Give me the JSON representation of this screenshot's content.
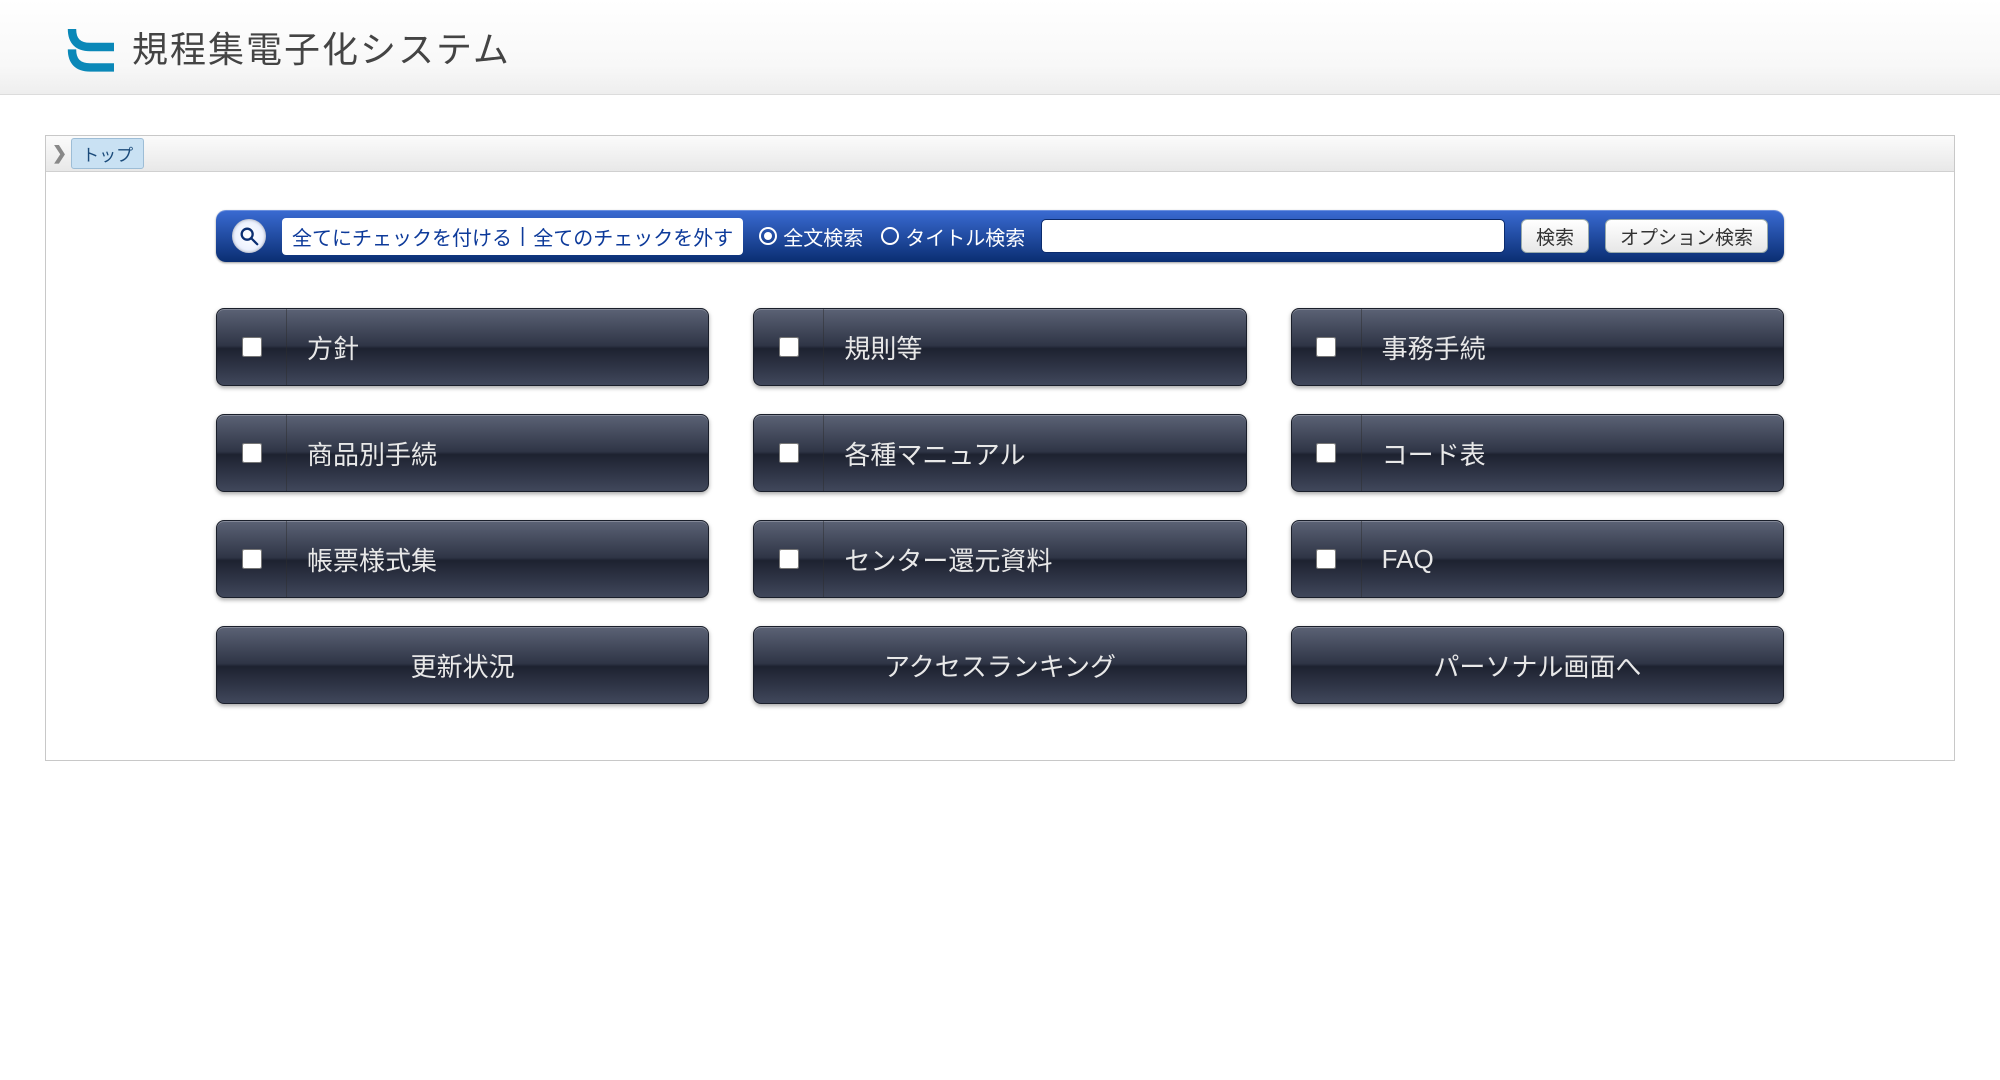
{
  "header": {
    "title": "規程集電子化システム"
  },
  "breadcrumb": {
    "top": "トップ"
  },
  "searchbar": {
    "check_all": "全てにチェックを付ける",
    "uncheck_all": "全てのチェックを外す",
    "radio_fulltext": "全文検索",
    "radio_title": "タイトル検索",
    "selected_radio": "fulltext",
    "input_value": "",
    "btn_search": "検索",
    "btn_option": "オプション検索"
  },
  "categories": [
    {
      "label": "方針"
    },
    {
      "label": "規則等"
    },
    {
      "label": "事務手続"
    },
    {
      "label": "商品別手続"
    },
    {
      "label": "各種マニュアル"
    },
    {
      "label": "コード表"
    },
    {
      "label": "帳票様式集"
    },
    {
      "label": "センター還元資料"
    },
    {
      "label": "FAQ"
    }
  ],
  "nav_tiles": [
    {
      "label": "更新状況"
    },
    {
      "label": "アクセスランキング"
    },
    {
      "label": "パーソナル画面へ"
    }
  ]
}
